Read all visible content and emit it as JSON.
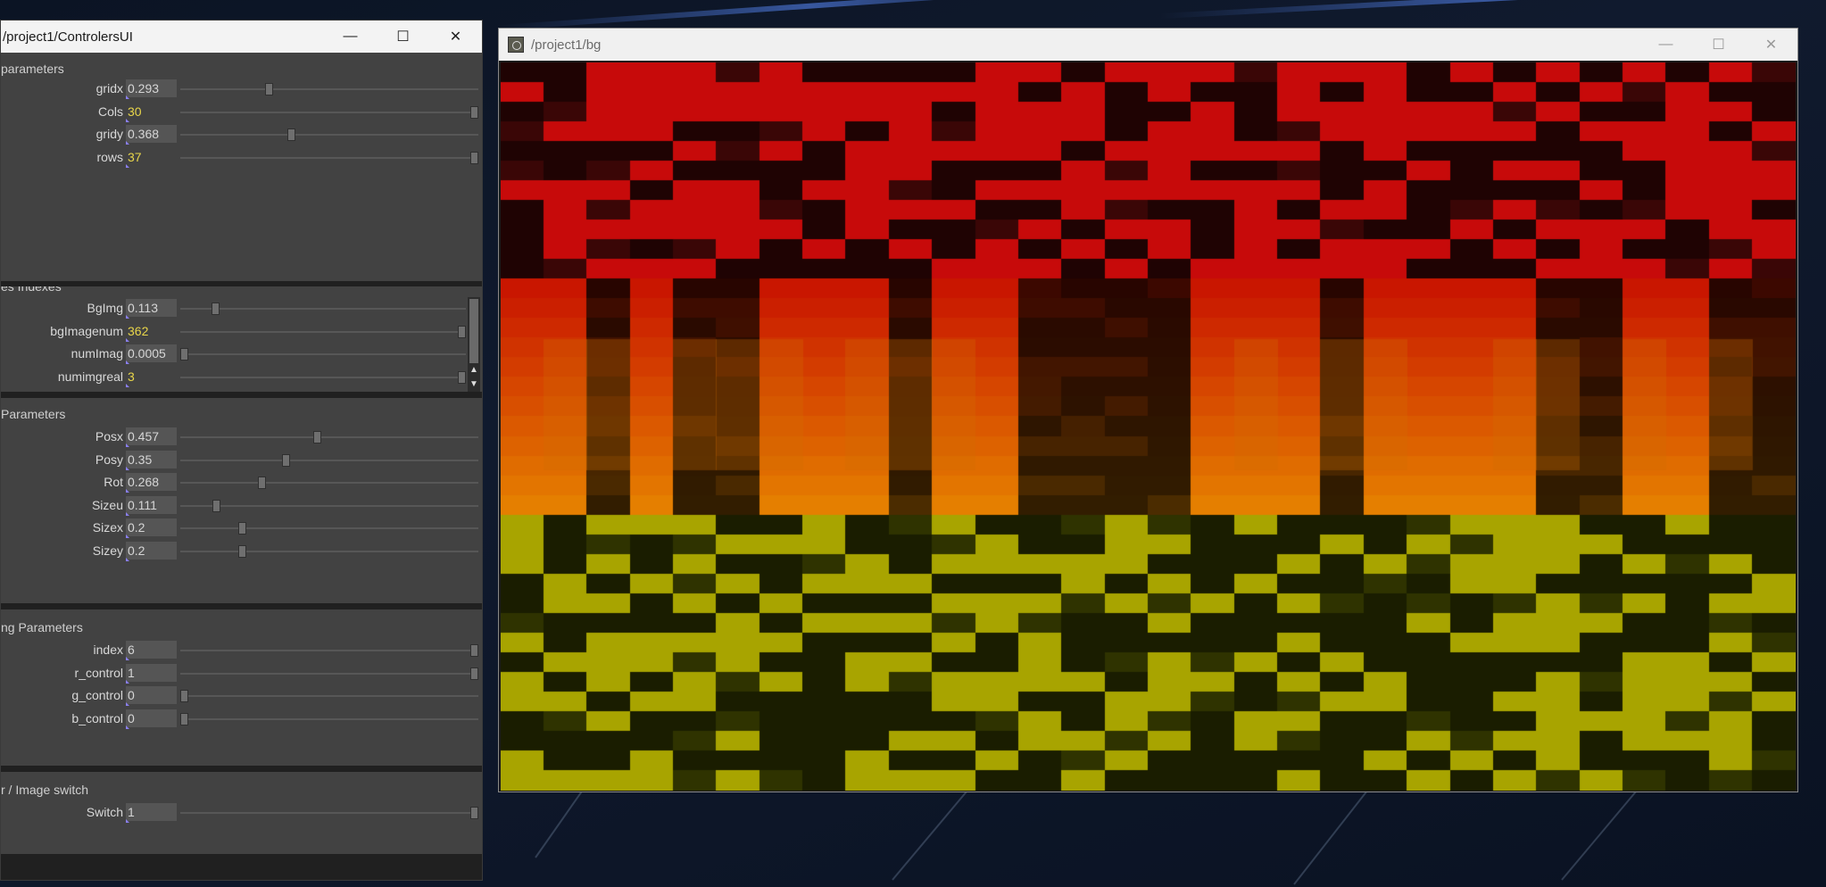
{
  "ctrl_window": {
    "title": "/project1/ControlersUI",
    "buttons": {
      "minimize": "—",
      "maximize": "☐",
      "close": "✕"
    },
    "panels": [
      {
        "title": "parameters",
        "rows": [
          {
            "label": "gridx",
            "value": "0.293",
            "kind": "float",
            "level": 0.293
          },
          {
            "label": "Cols",
            "value": "30",
            "kind": "int",
            "level": 1.0
          },
          {
            "label": "gridy",
            "value": "0.368",
            "kind": "float",
            "level": 0.368
          },
          {
            "label": "rows",
            "value": "37",
            "kind": "int",
            "level": 1.0
          }
        ]
      },
      {
        "title": "es Indexes",
        "rows": [
          {
            "label": "BgImg",
            "value": "0.113",
            "kind": "float",
            "level": 0.113
          },
          {
            "label": "bgImagenum",
            "value": "362",
            "kind": "int",
            "level": 1.0
          },
          {
            "label": "numImag",
            "value": "0.0005",
            "kind": "float",
            "level": 0.0005
          },
          {
            "label": "numimgreal",
            "value": "3",
            "kind": "int",
            "level": 1.0
          }
        ]
      },
      {
        "title": " Parameters",
        "rows": [
          {
            "label": "Posx",
            "value": "0.457",
            "kind": "float",
            "level": 0.457
          },
          {
            "label": "Posy",
            "value": "0.35",
            "kind": "float",
            "level": 0.35
          },
          {
            "label": "Rot",
            "value": "0.268",
            "kind": "float",
            "level": 0.268
          },
          {
            "label": "Sizeu",
            "value": "0.111",
            "kind": "float",
            "level": 0.111
          },
          {
            "label": "Sizex",
            "value": "0.2",
            "kind": "float",
            "level": 0.2
          },
          {
            "label": "Sizey",
            "value": "0.2",
            "kind": "float",
            "level": 0.2
          }
        ]
      },
      {
        "title": "ng Parameters",
        "rows": [
          {
            "label": "index",
            "value": "6",
            "kind": "intbox",
            "level": 1.0
          },
          {
            "label": "r_control",
            "value": "1",
            "kind": "intbox",
            "level": 1.0
          },
          {
            "label": "g_control",
            "value": "0",
            "kind": "intbox",
            "level": 0.0
          },
          {
            "label": "b_control",
            "value": "0",
            "kind": "intbox",
            "level": 0.0
          }
        ]
      },
      {
        "title": "r / Image switch",
        "rows": [
          {
            "label": "Switch",
            "value": "1",
            "kind": "intbox",
            "level": 1.0
          }
        ]
      }
    ]
  },
  "bg_window": {
    "title": "/project1/bg",
    "buttons": {
      "minimize": "—",
      "maximize": "☐",
      "close": "✕"
    },
    "grid": {
      "cols": 30,
      "rows": 37
    }
  },
  "colors": {
    "panel_bg": "#424242",
    "int_value": "#e8d54a",
    "red_cell": "#c80808",
    "yellow_cell": "#a8a400"
  }
}
